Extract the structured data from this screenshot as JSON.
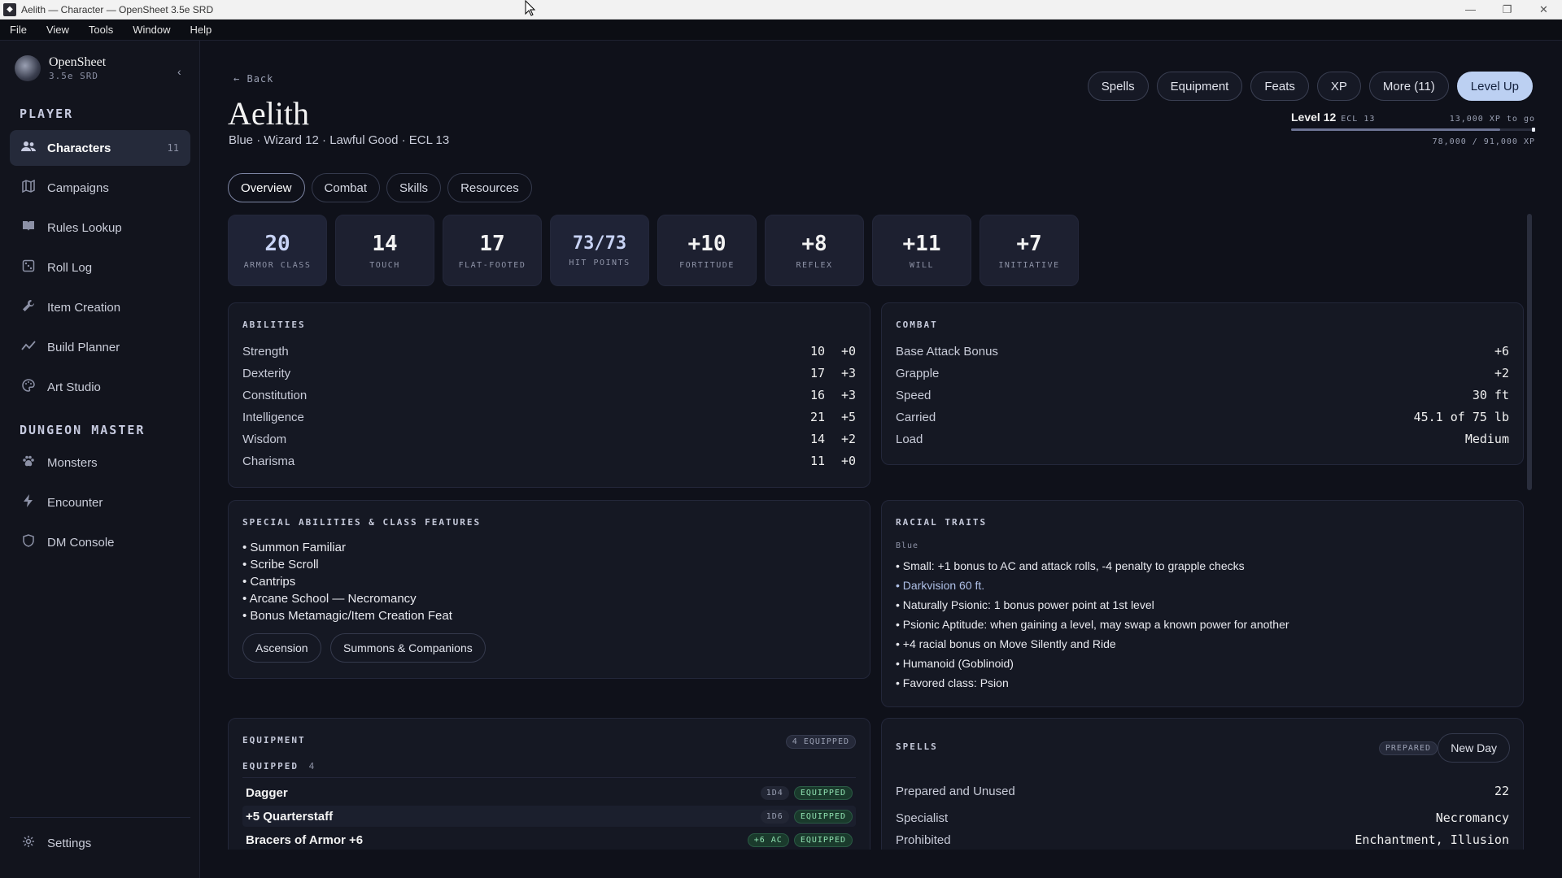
{
  "window": {
    "title": "Aelith — Character — OpenSheet 3.5e SRD"
  },
  "menu": [
    "File",
    "View",
    "Tools",
    "Window",
    "Help"
  ],
  "brand": {
    "name": "OpenSheet",
    "sub": "3.5e SRD"
  },
  "sidebar": {
    "player_label": "PLAYER",
    "dm_label": "DUNGEON MASTER",
    "player_items": [
      {
        "label": "Characters",
        "count": "11",
        "icon": "users-icon"
      },
      {
        "label": "Campaigns",
        "icon": "map-icon"
      },
      {
        "label": "Rules Lookup",
        "icon": "book-icon"
      },
      {
        "label": "Roll Log",
        "icon": "dice-icon"
      },
      {
        "label": "Item Creation",
        "icon": "wrench-icon"
      },
      {
        "label": "Build Planner",
        "icon": "chart-icon"
      },
      {
        "label": "Art Studio",
        "icon": "palette-icon"
      }
    ],
    "dm_items": [
      {
        "label": "Monsters",
        "icon": "paw-icon"
      },
      {
        "label": "Encounter",
        "icon": "bolt-icon"
      },
      {
        "label": "DM Console",
        "icon": "shield-icon"
      }
    ],
    "settings": "Settings"
  },
  "header": {
    "back": "Back",
    "name": "Aelith",
    "subtitle": "Blue · Wizard 12 · Lawful Good · ECL 13",
    "actions": [
      "Spells",
      "Equipment",
      "Feats",
      "XP",
      "More (11)"
    ],
    "primary_action": "Level Up"
  },
  "xp": {
    "level": "Level 12",
    "ecl": "ECL 13",
    "to_go": "13,000 XP to go",
    "total": "78,000 / 91,000 XP",
    "progress": 0.857
  },
  "tabs": [
    "Overview",
    "Combat",
    "Skills",
    "Resources"
  ],
  "stats": [
    {
      "value": "20",
      "label": "ARMOR CLASS"
    },
    {
      "value": "14",
      "label": "TOUCH"
    },
    {
      "value": "17",
      "label": "FLAT-FOOTED"
    },
    {
      "value": "73/73",
      "label": "HIT POINTS"
    },
    {
      "value": "+10",
      "label": "FORTITUDE"
    },
    {
      "value": "+8",
      "label": "REFLEX"
    },
    {
      "value": "+11",
      "label": "WILL"
    },
    {
      "value": "+7",
      "label": "INITIATIVE"
    }
  ],
  "abilities": {
    "title": "ABILITIES",
    "rows": [
      {
        "name": "Strength",
        "score": "10",
        "mod": "+0"
      },
      {
        "name": "Dexterity",
        "score": "17",
        "mod": "+3"
      },
      {
        "name": "Constitution",
        "score": "16",
        "mod": "+3"
      },
      {
        "name": "Intelligence",
        "score": "21",
        "mod": "+5"
      },
      {
        "name": "Wisdom",
        "score": "14",
        "mod": "+2"
      },
      {
        "name": "Charisma",
        "score": "11",
        "mod": "+0"
      }
    ]
  },
  "combat": {
    "title": "COMBAT",
    "rows": [
      {
        "name": "Base Attack Bonus",
        "value": "+6"
      },
      {
        "name": "Grapple",
        "value": "+2"
      },
      {
        "name": "Speed",
        "value": "30 ft"
      },
      {
        "name": "Carried",
        "value": "45.1 of 75 lb"
      },
      {
        "name": "Load",
        "value": "Medium"
      }
    ]
  },
  "special": {
    "title": "SPECIAL ABILITIES & CLASS FEATURES",
    "items": [
      "• Summon Familiar",
      "• Scribe Scroll",
      "• Cantrips",
      "• Arcane School — Necromancy",
      "• Bonus Metamagic/Item Creation Feat"
    ],
    "buttons": [
      "Ascension",
      "Summons & Companions"
    ]
  },
  "racial": {
    "title": "RACIAL TRAITS",
    "race": "Blue",
    "items": [
      "• Small: +1 bonus to AC and attack rolls, -4 penalty to grapple checks",
      "• Darkvision 60 ft.",
      "• Naturally Psionic: 1 bonus power point at 1st level",
      "• Psionic Aptitude: when gaining a level, may swap a known power for another",
      "• +4 racial bonus on Move Silently and Ride",
      "• Humanoid (Goblinoid)",
      "• Favored class: Psion"
    ]
  },
  "equipment": {
    "title": "EQUIPMENT",
    "badge": "4 EQUIPPED",
    "sub": "EQUIPPED",
    "sub_count": "4",
    "rows": [
      {
        "name": "Dagger",
        "tag": "1D4",
        "status": "EQUIPPED"
      },
      {
        "name": "+5 Quarterstaff",
        "tag": "1D6",
        "status": "EQUIPPED"
      },
      {
        "name": "Bracers of Armor +6",
        "tag": "+6 AC",
        "status": "EQUIPPED"
      }
    ]
  },
  "spells": {
    "title": "SPELLS",
    "badge": "PREPARED",
    "button": "New Day",
    "rows": [
      {
        "name": "Prepared and Unused",
        "value": "22"
      },
      {
        "name": "Specialist",
        "value": "Necromancy"
      },
      {
        "name": "Prohibited",
        "value": "Enchantment, Illusion"
      }
    ]
  }
}
